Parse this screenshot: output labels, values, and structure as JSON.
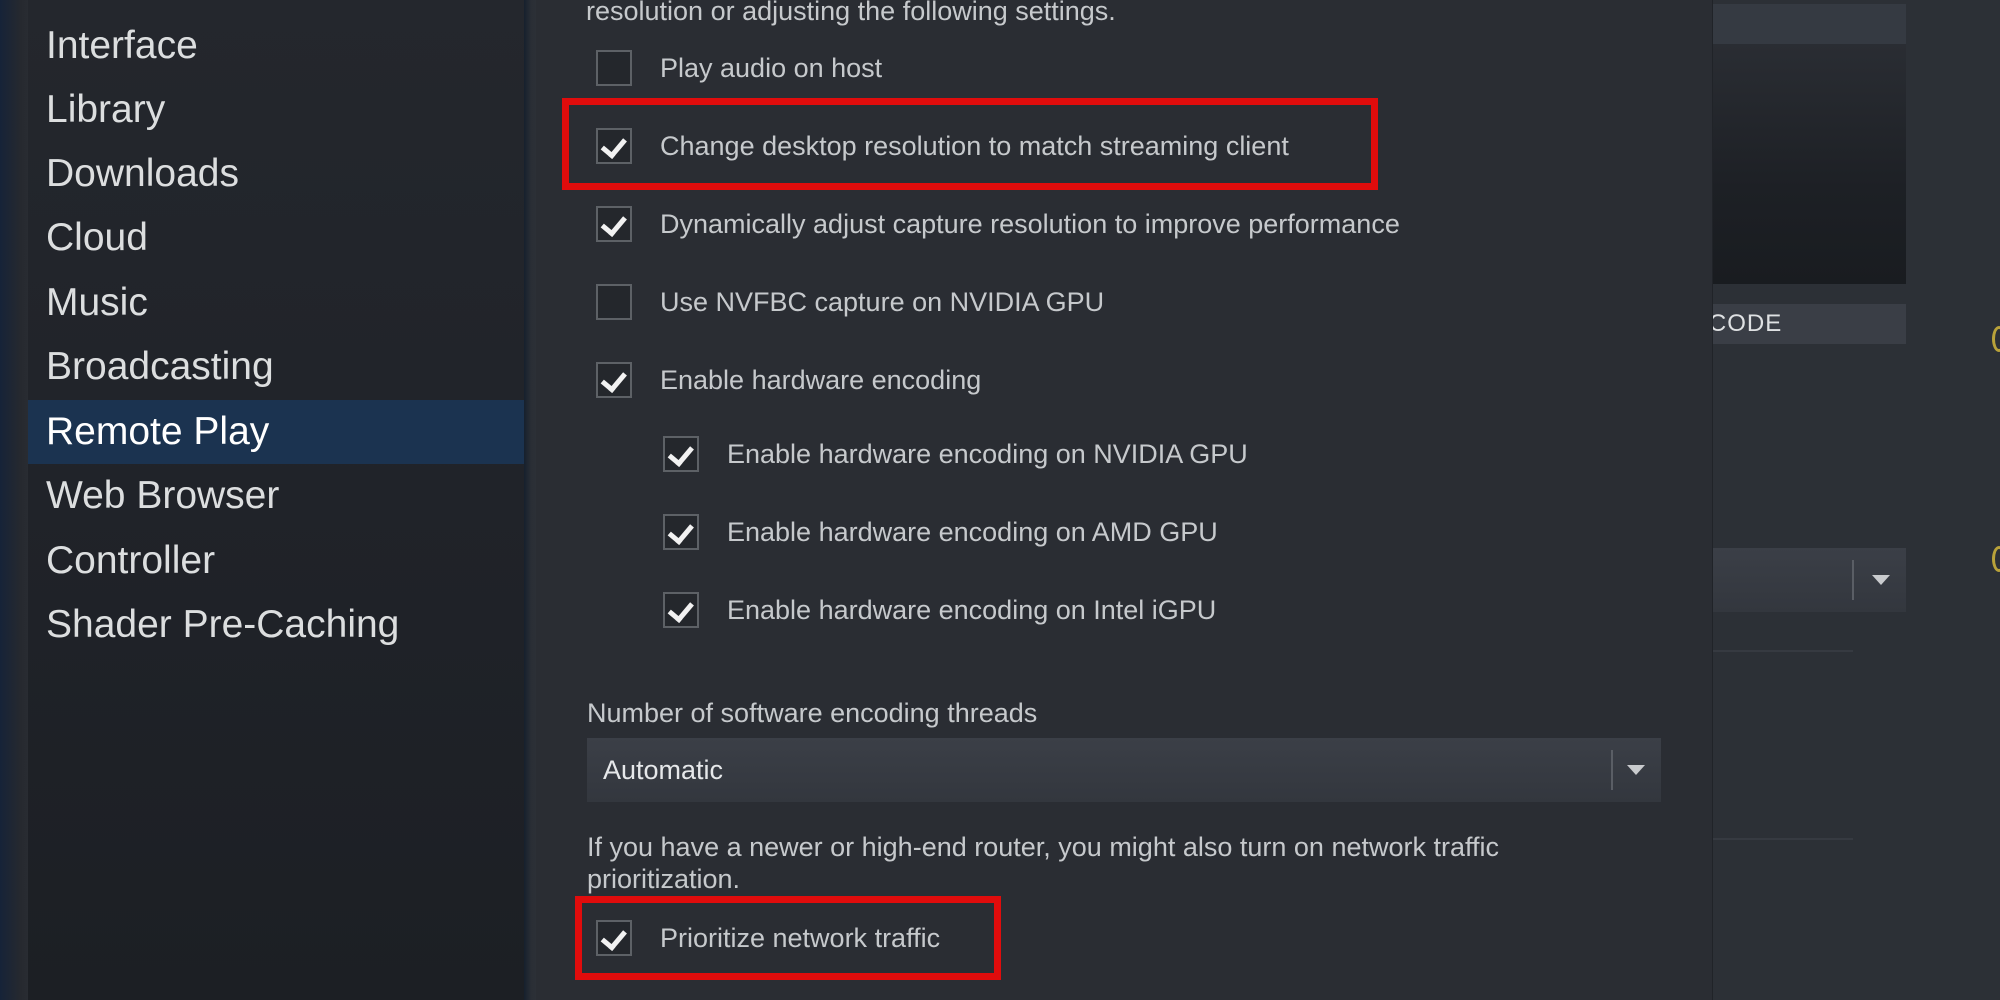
{
  "sidebar": {
    "items": [
      {
        "label": "Interface",
        "active": false
      },
      {
        "label": "Library",
        "active": false
      },
      {
        "label": "Downloads",
        "active": false
      },
      {
        "label": "Cloud",
        "active": false
      },
      {
        "label": "Music",
        "active": false
      },
      {
        "label": "Broadcasting",
        "active": false
      },
      {
        "label": "Remote Play",
        "active": true
      },
      {
        "label": "Web Browser",
        "active": false
      },
      {
        "label": "Controller",
        "active": false
      },
      {
        "label": "Shader Pre-Caching",
        "active": false
      }
    ]
  },
  "main": {
    "intro_text": "resolution or adjusting the following settings.",
    "options": [
      {
        "label": "Play audio on host",
        "checked": false
      },
      {
        "label": "Change desktop resolution to match streaming client",
        "checked": true,
        "highlighted": true
      },
      {
        "label": "Dynamically adjust capture resolution to improve performance",
        "checked": true
      },
      {
        "label": "Use NVFBC capture on NVIDIA GPU",
        "checked": false
      },
      {
        "label": "Enable hardware encoding",
        "checked": true
      },
      {
        "label": "Enable hardware encoding on NVIDIA GPU",
        "checked": true
      },
      {
        "label": "Enable hardware encoding on AMD GPU",
        "checked": true
      },
      {
        "label": "Enable hardware encoding on Intel iGPU",
        "checked": true
      }
    ],
    "threads_label": "Number of software encoding threads",
    "threads_value": "Automatic",
    "router_note_line1": "If you have a newer or high-end router, you might also turn on network traffic",
    "router_note_line2": "prioritization.",
    "prioritize": {
      "label": "Prioritize network traffic",
      "checked": true,
      "highlighted": true
    }
  },
  "right_panel": {
    "button_label_partial": "PAIR CODE"
  },
  "colors": {
    "highlight": "#e00c0c",
    "sidebar_active": "#1b3350",
    "panel_bg": "#2a2d33"
  }
}
